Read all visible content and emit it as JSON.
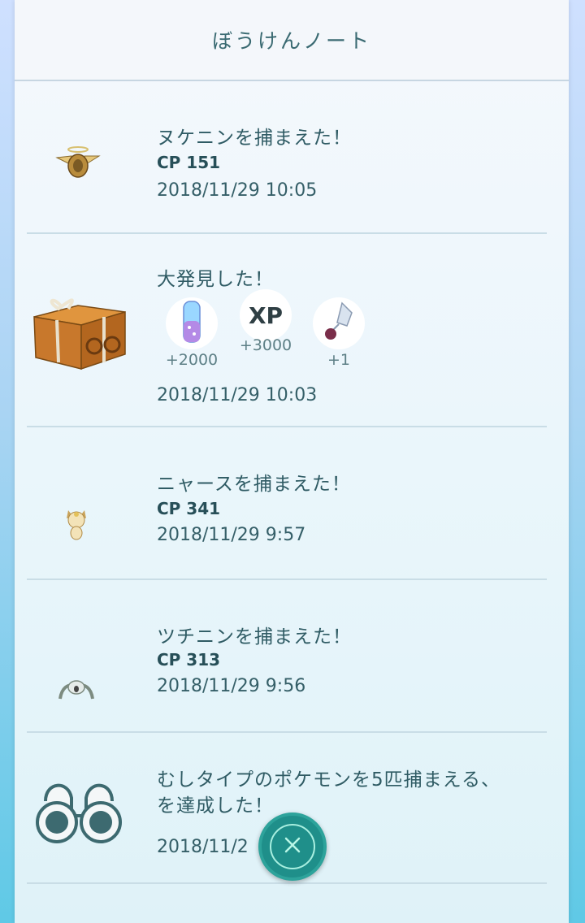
{
  "header": {
    "title": "ぼうけんノート"
  },
  "entries": [
    {
      "title": "ヌケニンを捕まえた！",
      "cp": "CP 151",
      "time": "2018/11/29 10:05"
    },
    {
      "title": "大発見した！",
      "rewards": [
        {
          "icon": "stardust-icon",
          "amount": "+2000"
        },
        {
          "icon": "xp-icon",
          "label": "XP",
          "amount": "+3000"
        },
        {
          "icon": "sinnoh-stone-icon",
          "amount": "+1"
        }
      ],
      "time": "2018/11/29 10:03"
    },
    {
      "title": "ニャースを捕まえた！",
      "cp": "CP 341",
      "time": "2018/11/29 9:57"
    },
    {
      "title": "ツチニンを捕まえた！",
      "cp": "CP 313",
      "time": "2018/11/29 9:56"
    },
    {
      "title_line1": "むしタイプのポケモンを5匹捕まえる、",
      "title_line2": "を達成した！",
      "time": "2018/11/2"
    }
  ],
  "close_button": {
    "icon": "close-icon"
  },
  "colors": {
    "accent": "#1f8f8a",
    "text": "#2f5b64"
  }
}
